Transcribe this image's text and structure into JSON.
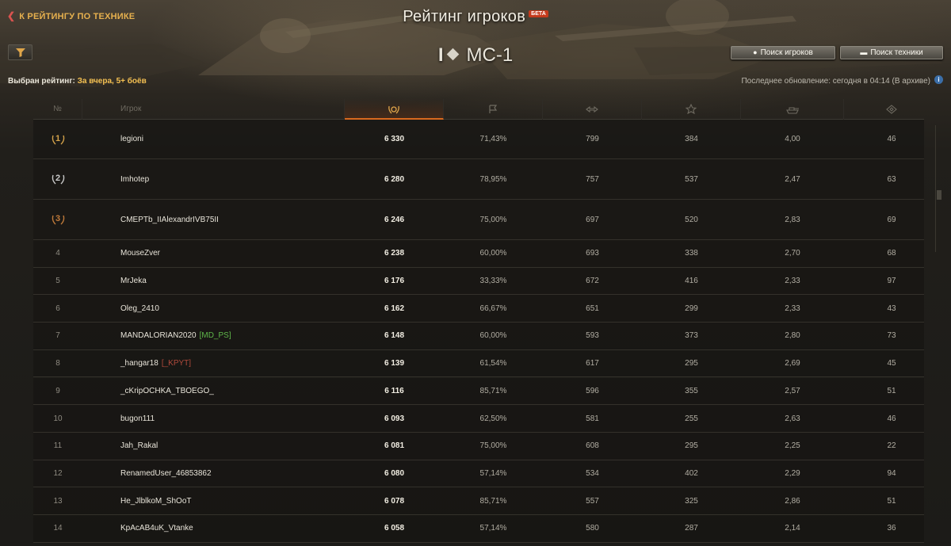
{
  "header": {
    "back_link": "К РЕЙТИНГУ ПО ТЕХНИКЕ",
    "title": "Рейтинг игроков",
    "beta": "БЕТА",
    "vehicle_tier": "I",
    "vehicle_name": "МС-1"
  },
  "filter": {
    "selected_label": "Выбран рейтинг:",
    "selected_value": "За вчера, 5+ боёв"
  },
  "buttons": {
    "search_players": "Поиск игроков",
    "search_tech": "Поиск техники"
  },
  "update": {
    "text": "Последнее обновление: сегодня в 04:14 (В архиве)"
  },
  "colors": {
    "accent": "#e6b04e",
    "active_tab": "#d96a1f",
    "clan_green": "#5fb84a",
    "clan_red": "#b04a3c"
  },
  "table": {
    "headers": {
      "rank": "№",
      "player": "Игрок",
      "rating_icon": "rating-laurel-icon",
      "wins_icon": "flag-icon",
      "damage_icon": "damage-icon",
      "exp_icon": "star-icon",
      "frags_icon": "tank-icon",
      "spot_icon": "spot-icon"
    },
    "rows": [
      {
        "rank": "1",
        "name": "legioni",
        "clan": "",
        "rating": "6 330",
        "wins": "71,43%",
        "damage": "799",
        "exp": "384",
        "frags": "4,00",
        "spot": "46"
      },
      {
        "rank": "2",
        "name": "Imhotep",
        "clan": "",
        "rating": "6 280",
        "wins": "78,95%",
        "damage": "757",
        "exp": "537",
        "frags": "2,47",
        "spot": "63"
      },
      {
        "rank": "3",
        "name": "CMEPTb_IIAlexandrIVB75II",
        "clan": "",
        "rating": "6 246",
        "wins": "75,00%",
        "damage": "697",
        "exp": "520",
        "frags": "2,83",
        "spot": "69"
      },
      {
        "rank": "4",
        "name": "MouseZver",
        "clan": "",
        "rating": "6 238",
        "wins": "60,00%",
        "damage": "693",
        "exp": "338",
        "frags": "2,70",
        "spot": "68"
      },
      {
        "rank": "5",
        "name": "MrJeka",
        "clan": "",
        "rating": "6 176",
        "wins": "33,33%",
        "damage": "672",
        "exp": "416",
        "frags": "2,33",
        "spot": "97"
      },
      {
        "rank": "6",
        "name": "Oleg_2410",
        "clan": "",
        "rating": "6 162",
        "wins": "66,67%",
        "damage": "651",
        "exp": "299",
        "frags": "2,33",
        "spot": "43"
      },
      {
        "rank": "7",
        "name": "MANDALORIAN2020",
        "clan": "[MD_PS]",
        "rating": "6 148",
        "wins": "60,00%",
        "damage": "593",
        "exp": "373",
        "frags": "2,80",
        "spot": "73"
      },
      {
        "rank": "8",
        "name": "_hangar18",
        "clan": "[_KPYT]",
        "rating": "6 139",
        "wins": "61,54%",
        "damage": "617",
        "exp": "295",
        "frags": "2,69",
        "spot": "45"
      },
      {
        "rank": "9",
        "name": "_cKripOCHKA_TBOEGO_",
        "clan": "",
        "rating": "6 116",
        "wins": "85,71%",
        "damage": "596",
        "exp": "355",
        "frags": "2,57",
        "spot": "51"
      },
      {
        "rank": "10",
        "name": "bugon111",
        "clan": "",
        "rating": "6 093",
        "wins": "62,50%",
        "damage": "581",
        "exp": "255",
        "frags": "2,63",
        "spot": "46"
      },
      {
        "rank": "11",
        "name": "Jah_Rakal",
        "clan": "",
        "rating": "6 081",
        "wins": "75,00%",
        "damage": "608",
        "exp": "295",
        "frags": "2,25",
        "spot": "22"
      },
      {
        "rank": "12",
        "name": "RenamedUser_46853862",
        "clan": "",
        "rating": "6 080",
        "wins": "57,14%",
        "damage": "534",
        "exp": "402",
        "frags": "2,29",
        "spot": "94"
      },
      {
        "rank": "13",
        "name": "He_JlblkoM_ShOoT",
        "clan": "",
        "rating": "6 078",
        "wins": "85,71%",
        "damage": "557",
        "exp": "325",
        "frags": "2,86",
        "spot": "51"
      },
      {
        "rank": "14",
        "name": "KpAcAB4uK_Vtanke",
        "clan": "",
        "rating": "6 058",
        "wins": "57,14%",
        "damage": "580",
        "exp": "287",
        "frags": "2,14",
        "spot": "36"
      }
    ]
  }
}
